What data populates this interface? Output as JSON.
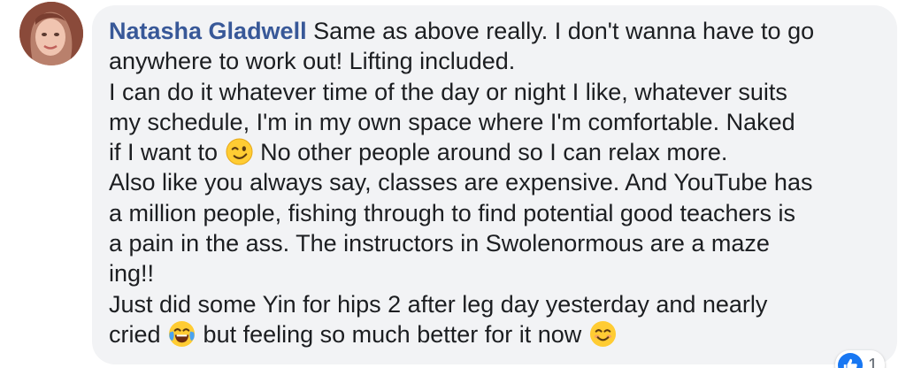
{
  "comment": {
    "author": "Natasha Gladwell",
    "lines": [
      " Same as above really. I don't wanna have to go",
      "anywhere to work out! Lifting included.",
      "I can do it whatever time of the day or night I like, whatever suits",
      "my schedule, I'm in my own space where I'm comfortable. Naked",
      "if I want to",
      " No other people around so I can relax more.",
      "Also like you always say, classes are expensive. And YouTube has",
      "a million people, fishing through to find potential good teachers is",
      "a pain in the ass. The instructors in Swolenormous are a maze",
      "ing!!",
      "Just did some Yin for hips 2 after leg day yesterday and nearly",
      "cried",
      " but feeling so much better for it now"
    ],
    "emojis": {
      "wink": "winking-face-emoji",
      "laugh": "tears-of-joy-emoji",
      "smile": "smiling-face-emoji"
    }
  },
  "reactions": {
    "icon": "thumbs-up-icon",
    "count": "1",
    "color": "#1877f2"
  },
  "colors": {
    "author": "#385898",
    "text": "#1c1e21",
    "bubble": "#f2f3f5"
  }
}
